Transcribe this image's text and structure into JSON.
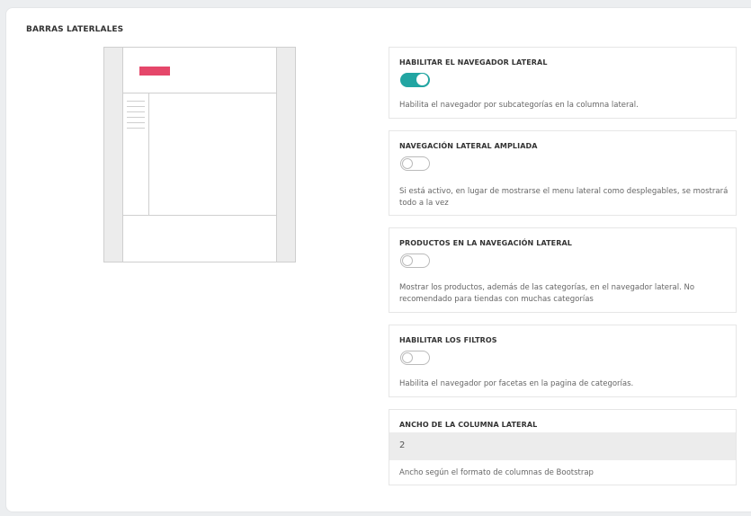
{
  "section": {
    "title": "BARRAS LATERLALES"
  },
  "colors": {
    "accent": "#22a5a2",
    "logo_bar": "#e5476a"
  },
  "options": [
    {
      "label": "HABILITAR EL NAVEGADOR LATERAL",
      "enabled": true,
      "description": "Habilita el navegador por subcategorías en la columna lateral."
    },
    {
      "label": "NAVEGACIÓN LATERAL AMPLIADA",
      "enabled": false,
      "description": "Si está activo, en lugar de mostrarse el menu lateral como desplegables, se mostrará todo a la vez"
    },
    {
      "label": "PRODUCTOS EN LA NAVEGACIÓN LATERAL",
      "enabled": false,
      "description": "Mostrar los productos, además de las categorías, en el navegador lateral. No recomendado para tiendas con muchas categorías"
    },
    {
      "label": "HABILITAR LOS FILTROS",
      "enabled": false,
      "description": "Habilita el navegador por facetas en la pagina de categorías."
    }
  ],
  "column_width": {
    "label": "ANCHO DE LA COLUMNA LATERAL",
    "value": "2",
    "description": "Ancho según el formato de columnas de Bootstrap"
  }
}
